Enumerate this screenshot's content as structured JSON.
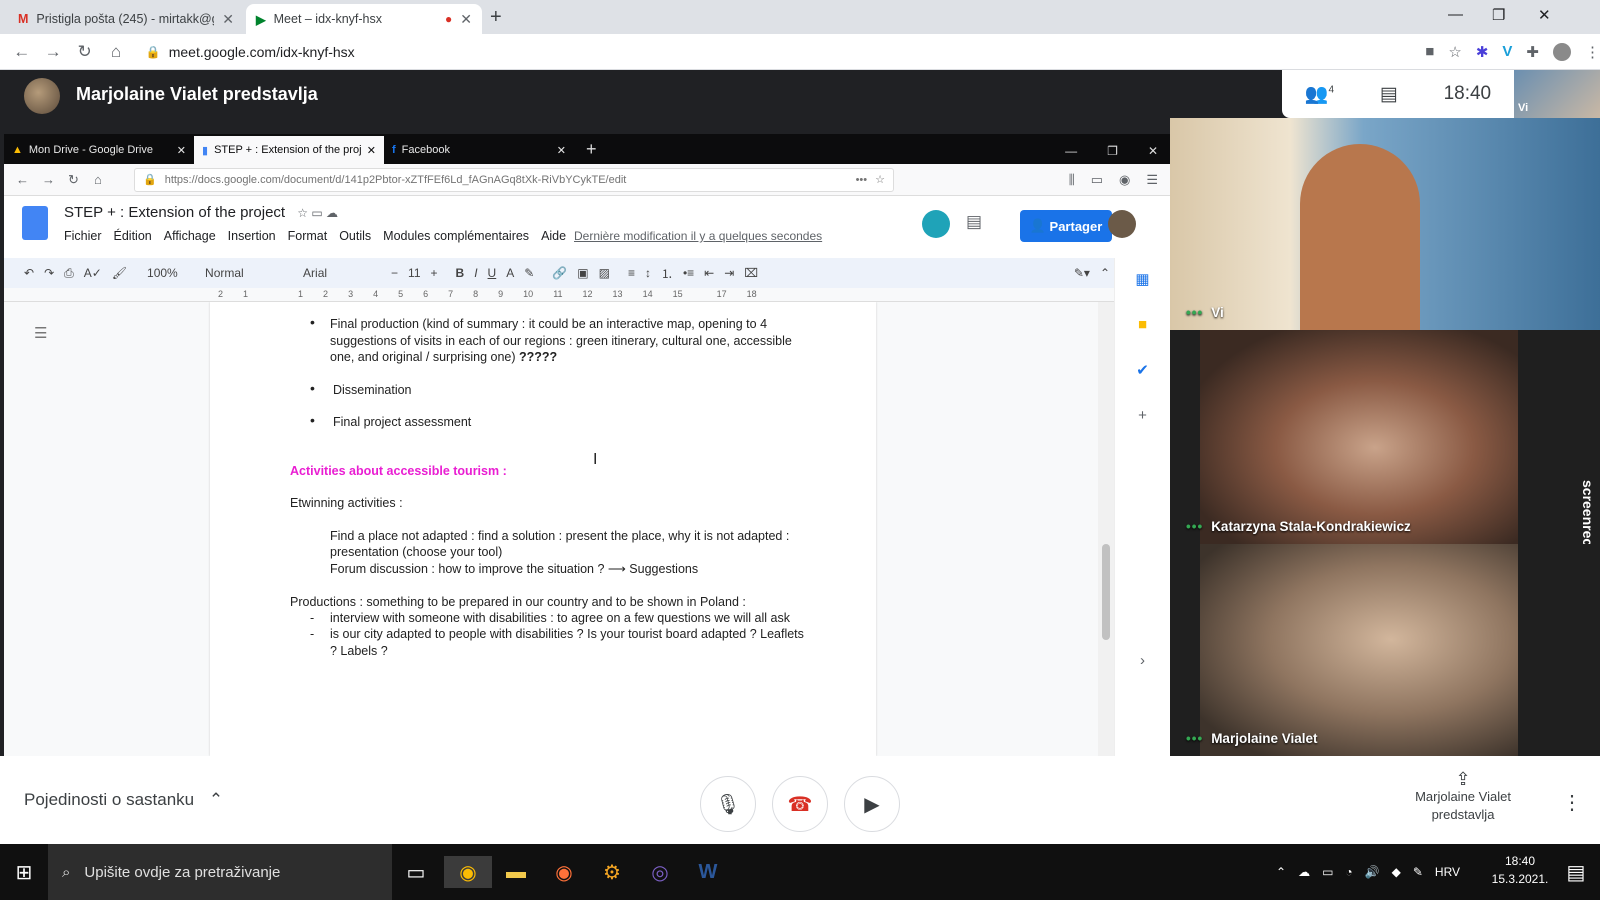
{
  "browser": {
    "tabs": [
      {
        "title": "Pristigla pošta (245) - mirtakk@g",
        "icon": "gmail-icon"
      },
      {
        "title": "Meet – idx-knyf-hsx",
        "icon": "meet-icon",
        "recording": true
      }
    ],
    "url": "meet.google.com/idx-knyf-hsx"
  },
  "meet": {
    "presenting_title": "Marjolaine Vialet predstavlja",
    "participants_count": "4",
    "time": "18:40",
    "self_label": "Vi",
    "participants": [
      {
        "name": "Vi"
      },
      {
        "name": "Katarzyna Stala-Kondrakiewicz"
      },
      {
        "name": "Marjolaine Vialet"
      }
    ],
    "details_label": "Pojedinosti o sastanku",
    "presenter_info": "Marjolaine Vialet predstavlja",
    "side_watermark": "screenrec"
  },
  "shared": {
    "tabs": [
      {
        "title": "Mon Drive - Google Drive"
      },
      {
        "title": "STEP + : Extension of the proje"
      },
      {
        "title": "Facebook"
      }
    ],
    "url": "https://docs.google.com/document/d/141p2Pbtor-xZTfFEf6Ld_fAGnAGq8tXk-RiVbYCykTE/edit",
    "doc": {
      "title": "STEP + : Extension of the project",
      "menu": [
        "Fichier",
        "Édition",
        "Affichage",
        "Insertion",
        "Format",
        "Outils",
        "Modules complémentaires",
        "Aide"
      ],
      "last_modified": "Dernière modification il y a quelques secondes",
      "share_label": "Partager",
      "toolbar": {
        "zoom": "100%",
        "style": "Normal",
        "font": "Arial",
        "size": "11"
      },
      "ruler_marks": [
        "2",
        "1",
        "1",
        "2",
        "3",
        "4",
        "5",
        "6",
        "7",
        "8",
        "9",
        "10",
        "11",
        "12",
        "13",
        "14",
        "15",
        "17",
        "18"
      ],
      "lines": {
        "b1a": "Final production (kind of summary : it could be an interactive map, opening to 4",
        "b1b": "suggestions of visits in each of our regions : green itinerary, cultural one, accessible",
        "b1c": "one, and original / surprising one)",
        "b1d": "?????",
        "b2": "Dissemination",
        "b3": "Final project assessment",
        "heading": "Activities about accessible tourism :",
        "etw": "Etwinning activities :",
        "f1": "Find a place not adapted : find a solution : present the place, why it is not adapted :",
        "f2": "presentation (choose your tool)",
        "f3": "Forum discussion : how to improve the situation ? ⟶  Suggestions",
        "p1": "Productions :  something to be prepared in our country and to be shown in Poland :",
        "p2": "interview with someone with disabilities : to agree on a few questions we will all ask",
        "p3": "is our city adapted to people with disabilities ? Is your tourist board adapted ? Leaflets",
        "p4": "?  Labels ?"
      }
    }
  },
  "taskbar": {
    "search_placeholder": "Upišite ovdje za pretraživanje",
    "language": "HRV",
    "time": "18:40",
    "date": "15.3.2021."
  },
  "colors": {
    "accent": "#1a73e8",
    "heading_magenta": "#e91ed2"
  }
}
